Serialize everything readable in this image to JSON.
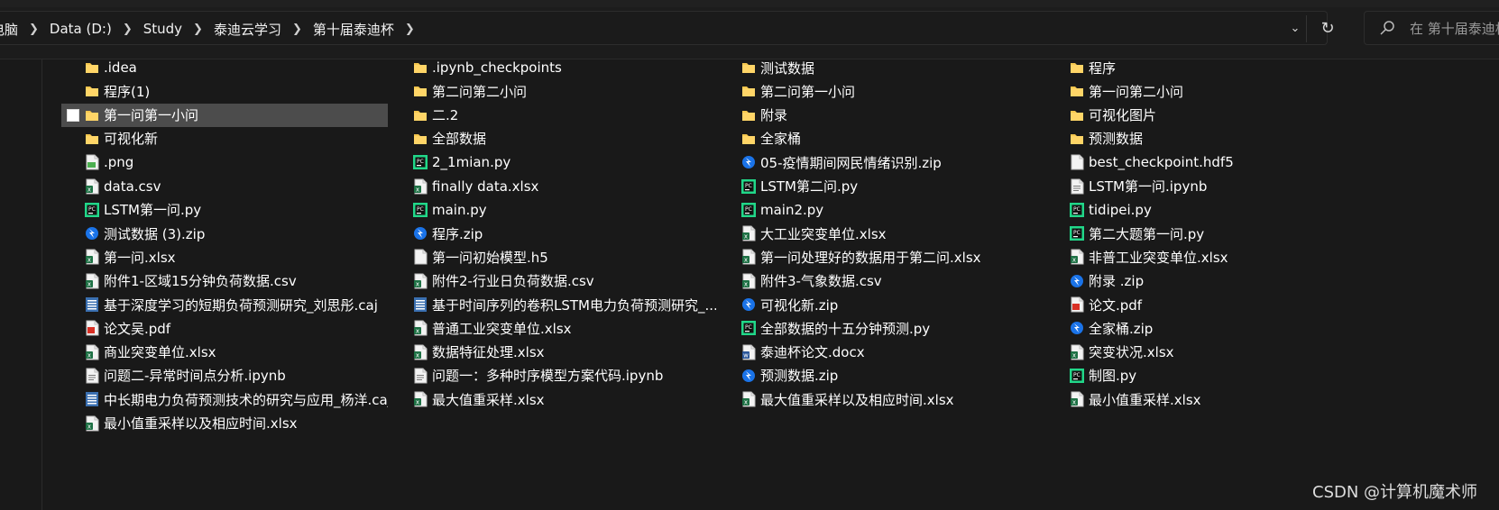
{
  "window": {
    "breadcrumb": [
      "电脑",
      "Data (D:)",
      "Study",
      "泰迪云学习",
      "第十届泰迪杯"
    ],
    "search_placeholder": "在 第十届泰迪杯"
  },
  "colors": {
    "background": "#191919",
    "selection": "#4c4c4c",
    "folder": "#f4c64e",
    "excel": "#1e7145",
    "pycharm": "#21d789",
    "zip": "#1a73e8",
    "pdf": "#d93025"
  },
  "columns": [
    [
      {
        "name": ".idea",
        "icon": "folder-icon"
      },
      {
        "name": "程序(1)",
        "icon": "folder-icon"
      },
      {
        "name": "第一问第一小问",
        "icon": "folder-icon",
        "selected": true
      },
      {
        "name": "可视化新",
        "icon": "folder-icon"
      },
      {
        "name": ".png",
        "icon": "image-file-icon"
      },
      {
        "name": "data.csv",
        "icon": "excel-file-icon"
      },
      {
        "name": "LSTM第一问.py",
        "icon": "pycharm-file-icon"
      },
      {
        "name": "测试数据 (3).zip",
        "icon": "zip-file-icon"
      },
      {
        "name": "第一问.xlsx",
        "icon": "excel-file-icon"
      },
      {
        "name": "附件1-区域15分钟负荷数据.csv",
        "icon": "excel-file-icon"
      },
      {
        "name": "基于深度学习的短期负荷预测研究_刘思彤.caj",
        "icon": "caj-file-icon"
      },
      {
        "name": "论文吴.pdf",
        "icon": "pdf-file-icon"
      },
      {
        "name": "商业突变单位.xlsx",
        "icon": "excel-file-icon"
      },
      {
        "name": "问题二-异常时间点分析.ipynb",
        "icon": "text-file-icon"
      },
      {
        "name": "中长期电力负荷预测技术的研究与应用_杨洋.caj",
        "icon": "caj-file-icon"
      },
      {
        "name": "最小值重采样以及相应时间.xlsx",
        "icon": "excel-file-icon"
      }
    ],
    [
      {
        "name": ".ipynb_checkpoints",
        "icon": "folder-icon"
      },
      {
        "name": "第二问第二小问",
        "icon": "folder-icon"
      },
      {
        "name": "二.2",
        "icon": "folder-icon"
      },
      {
        "name": "全部数据",
        "icon": "folder-icon"
      },
      {
        "name": "2_1mian.py",
        "icon": "pycharm-file-icon"
      },
      {
        "name": "finally data.xlsx",
        "icon": "excel-file-icon"
      },
      {
        "name": "main.py",
        "icon": "pycharm-file-icon"
      },
      {
        "name": "程序.zip",
        "icon": "zip-file-icon"
      },
      {
        "name": "第一问初始模型.h5",
        "icon": "blank-file-icon"
      },
      {
        "name": "附件2-行业日负荷数据.csv",
        "icon": "excel-file-icon"
      },
      {
        "name": "基于时间序列的卷积LSTM电力负荷预测研究_...",
        "icon": "caj-file-icon"
      },
      {
        "name": "普通工业突变单位.xlsx",
        "icon": "excel-file-icon"
      },
      {
        "name": "数据特征处理.xlsx",
        "icon": "excel-file-icon"
      },
      {
        "name": "问题一：多种时序模型方案代码.ipynb",
        "icon": "text-file-icon"
      },
      {
        "name": "最大值重采样.xlsx",
        "icon": "excel-file-icon"
      }
    ],
    [
      {
        "name": "测试数据",
        "icon": "folder-icon"
      },
      {
        "name": "第二问第一小问",
        "icon": "folder-icon"
      },
      {
        "name": "附录",
        "icon": "folder-icon"
      },
      {
        "name": "全家桶",
        "icon": "folder-icon"
      },
      {
        "name": "05-疫情期间网民情绪识别.zip",
        "icon": "zip-file-icon"
      },
      {
        "name": "LSTM第二问.py",
        "icon": "pycharm-file-icon"
      },
      {
        "name": "main2.py",
        "icon": "pycharm-file-icon"
      },
      {
        "name": "大工业突变单位.xlsx",
        "icon": "excel-file-icon"
      },
      {
        "name": "第一问处理好的数据用于第二问.xlsx",
        "icon": "excel-file-icon"
      },
      {
        "name": "附件3-气象数据.csv",
        "icon": "excel-file-icon"
      },
      {
        "name": "可视化新.zip",
        "icon": "zip-file-icon"
      },
      {
        "name": "全部数据的十五分钟预测.py",
        "icon": "pycharm-file-icon"
      },
      {
        "name": "泰迪杯论文.docx",
        "icon": "word-file-icon"
      },
      {
        "name": "预测数据.zip",
        "icon": "zip-file-icon"
      },
      {
        "name": "最大值重采样以及相应时间.xlsx",
        "icon": "excel-file-icon"
      }
    ],
    [
      {
        "name": "程序",
        "icon": "folder-icon"
      },
      {
        "name": "第一问第二小问",
        "icon": "folder-icon"
      },
      {
        "name": "可视化图片",
        "icon": "folder-icon"
      },
      {
        "name": "预测数据",
        "icon": "folder-icon"
      },
      {
        "name": "best_checkpoint.hdf5",
        "icon": "blank-file-icon"
      },
      {
        "name": "LSTM第一问.ipynb",
        "icon": "text-file-icon"
      },
      {
        "name": "tidipei.py",
        "icon": "pycharm-file-icon"
      },
      {
        "name": "第二大题第一问.py",
        "icon": "pycharm-file-icon"
      },
      {
        "name": "非普工业突变单位.xlsx",
        "icon": "excel-file-icon"
      },
      {
        "name": "附录 .zip",
        "icon": "zip-file-icon"
      },
      {
        "name": "论文.pdf",
        "icon": "pdf-file-icon"
      },
      {
        "name": "全家桶.zip",
        "icon": "zip-file-icon"
      },
      {
        "name": "突变状况.xlsx",
        "icon": "excel-file-icon"
      },
      {
        "name": "制图.py",
        "icon": "pycharm-file-icon"
      },
      {
        "name": "最小值重采样.xlsx",
        "icon": "excel-file-icon"
      }
    ]
  ],
  "watermark": "CSDN @计算机魔术师"
}
